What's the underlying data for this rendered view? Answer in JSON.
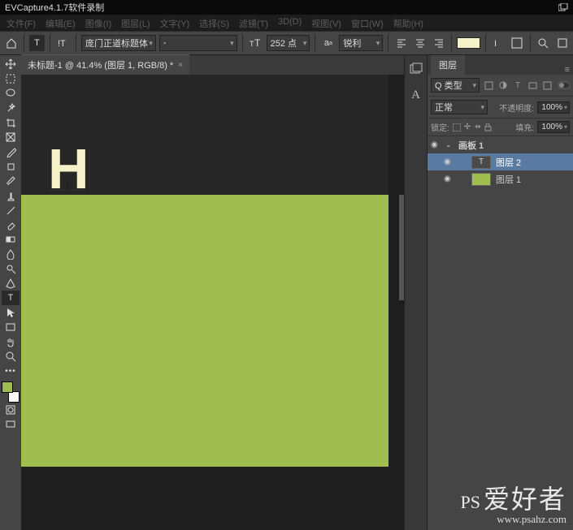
{
  "title": "EVCapture4.1.7软件录制",
  "menu": {
    "file": "文件(F)",
    "edit": "编辑(E)",
    "image": "图像(I)",
    "layer": "图层(L)",
    "text": "文字(Y)",
    "select": "选择(S)",
    "filter": "滤镜(T)",
    "d3": "3D(D)",
    "view": "视图(V)",
    "window": "窗口(W)",
    "help": "帮助(H)"
  },
  "options": {
    "font_family": "庞门正道标题体",
    "font_style": "-",
    "font_size": "252 点",
    "aa": "锐利",
    "text_color": "#f5f2c8"
  },
  "tab": {
    "label": "未标题-1 @ 41.4% (图层 1, RGB/8) *"
  },
  "canvas": {
    "letter": "H",
    "artboard_color": "#9fbe4f"
  },
  "panel": {
    "title": "图层",
    "filter_kind": "Q 类型",
    "blend": "正常",
    "opacity_label": "不透明度:",
    "opacity_value": "100%",
    "lock_label": "锁定:",
    "fill_label": "填充:",
    "fill_value": "100%",
    "layers": [
      {
        "name": "画板 1",
        "kind": "group"
      },
      {
        "name": "图层 2",
        "kind": "text"
      },
      {
        "name": "图层 1",
        "kind": "raster"
      }
    ]
  },
  "watermark": {
    "brand": "爱好者",
    "prefix": "PS",
    "url": "www.psahz.com"
  }
}
